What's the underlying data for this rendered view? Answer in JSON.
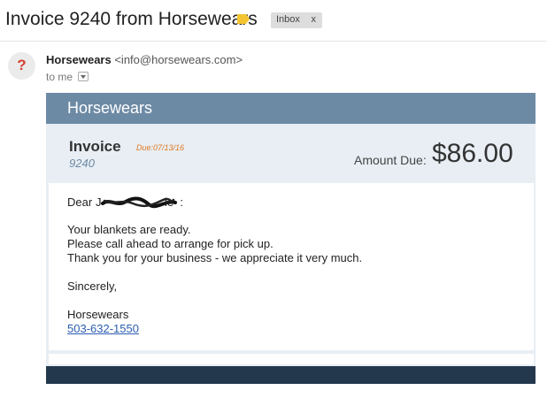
{
  "email": {
    "subject": "Invoice 9240 from Horsewears",
    "label_chip": "Inbox",
    "chip_close": "x",
    "label_icon": "label-tag-icon",
    "sender_name": "Horsewears",
    "sender_email": "<info@horsewears.com>",
    "recipient": "to me",
    "avatar_glyph": "?"
  },
  "invoice": {
    "brand": "Horsewears",
    "title": "Invoice",
    "due": "Due:07/13/16",
    "number": "9240",
    "amount_label": "Amount Due:",
    "amount": "$86.00",
    "greeting_start": "Dear ",
    "greeting_end": " :",
    "line1": "Your blankets are ready.",
    "line2": "Please call ahead to arrange for pick up.",
    "line3": "Thank you for your business - we appreciate it very much.",
    "closing": "Sincerely,",
    "signature": "Horsewears",
    "phone": "503-632-1550"
  },
  "colors": {
    "brand_bar": "#6d8aa5",
    "due_text": "#e07820",
    "footer": "#24384d",
    "link": "#2a5db0",
    "label_tag": "#f4c430"
  }
}
